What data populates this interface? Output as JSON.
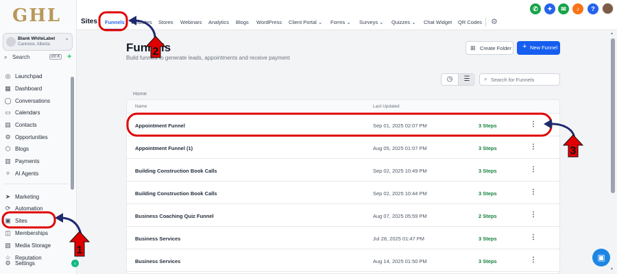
{
  "brand": {
    "logo": "GHL"
  },
  "account": {
    "name": "Blank WhiteLabel",
    "location": "Canmore, Alberta"
  },
  "sidebar": {
    "search_label": "Search",
    "shortcut": "ctrl K",
    "items": [
      {
        "label": "Launchpad",
        "icon": "rocket-icon"
      },
      {
        "label": "Dashboard",
        "icon": "dashboard-icon"
      },
      {
        "label": "Conversations",
        "icon": "chat-icon"
      },
      {
        "label": "Calendars",
        "icon": "calendar-icon"
      },
      {
        "label": "Contacts",
        "icon": "contacts-icon"
      },
      {
        "label": "Opportunities",
        "icon": "funnel-icon"
      },
      {
        "label": "Blogs",
        "icon": "blog-icon"
      },
      {
        "label": "Payments",
        "icon": "payments-icon"
      },
      {
        "label": "AI Agents",
        "icon": "ai-icon"
      },
      {
        "label": "Marketing",
        "icon": "send-icon"
      },
      {
        "label": "Automation",
        "icon": "automation-icon"
      },
      {
        "label": "Sites",
        "icon": "sites-icon"
      },
      {
        "label": "Memberships",
        "icon": "membership-icon"
      },
      {
        "label": "Media Storage",
        "icon": "media-icon"
      },
      {
        "label": "Reputation",
        "icon": "star-icon"
      },
      {
        "label": "Settings",
        "icon": "gear-icon"
      }
    ]
  },
  "topnav": {
    "title": "Sites",
    "tabs": [
      "Funnels",
      "Websites",
      "Stores",
      "Webinars",
      "Analytics",
      "Blogs",
      "WordPress",
      "Client Portal",
      "Forms",
      "Surveys",
      "Quizzes",
      "Chat Widget",
      "QR Codes"
    ],
    "active_tab": "Funnels"
  },
  "header": {
    "title": "Funnels",
    "subtitle": "Build funnels to generate leads, appointments and receive payment",
    "create_folder": "Create Folder",
    "new_funnel": "New Funnel"
  },
  "search": {
    "placeholder": "Search for Funnels"
  },
  "breadcrumb": "Home",
  "table": {
    "columns": [
      "Name",
      "Last Updated"
    ],
    "rows": [
      {
        "name": "Appointment Funnel",
        "updated": "Sep 01, 2025 02:07 PM",
        "steps": "3 Steps"
      },
      {
        "name": "Appointment Funnel (1)",
        "updated": "Aug 05, 2025 01:07 PM",
        "steps": "3 Steps"
      },
      {
        "name": "Building Construction Book Calls",
        "updated": "Sep 02, 2025 10:49 PM",
        "steps": "3 Steps"
      },
      {
        "name": "Building Construction Book Calls",
        "updated": "Sep 02, 2025 10:44 PM",
        "steps": "3 Steps"
      },
      {
        "name": "Business Coaching Quiz Funnel",
        "updated": "Aug 07, 2025 05:59 PM",
        "steps": "2 Steps"
      },
      {
        "name": "Business Services",
        "updated": "Jul 28, 2025 01:47 PM",
        "steps": "3 Steps"
      },
      {
        "name": "Business Services",
        "updated": "Aug 14, 2025 01:50 PM",
        "steps": "3 Steps"
      }
    ]
  },
  "annotations": {
    "step1": "1",
    "step2": "2",
    "step3": "3"
  },
  "colors": {
    "accent": "#155eef",
    "annotation": "#e00000",
    "arrow": "#1e2a6e",
    "steps": "#15803d"
  }
}
